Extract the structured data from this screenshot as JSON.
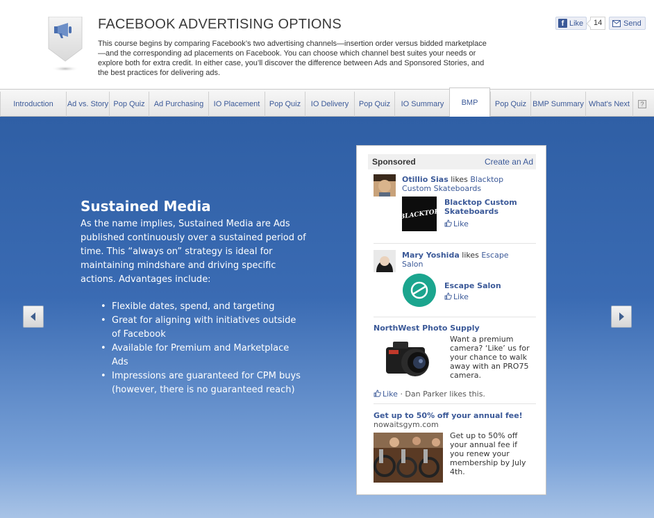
{
  "header": {
    "title": "FACEBOOK ADVERTISING OPTIONS",
    "description": "This course begins by comparing Facebook’s two advertising channels—insertion order versus bidded marketplace—and the corresponding ad placements on Facebook. You can choose which channel best suites your needs or explore both for extra credit. In either case, you’ll discover the difference between Ads and Sponsored Stories, and the best practices for delivering ads.",
    "like_label": "Like",
    "like_count": "14",
    "send_label": "Send"
  },
  "tabs": [
    {
      "label": "Introduction"
    },
    {
      "label": "Ad vs. Story"
    },
    {
      "label": "Pop Quiz"
    },
    {
      "label": "Ad Purchasing"
    },
    {
      "label": "IO Placement"
    },
    {
      "label": "Pop Quiz"
    },
    {
      "label": "IO Delivery"
    },
    {
      "label": "Pop Quiz"
    },
    {
      "label": "IO Summary"
    },
    {
      "label": "BMP",
      "active": true
    },
    {
      "label": "Pop Quiz"
    },
    {
      "label": "BMP Summary"
    },
    {
      "label": "What's Next"
    }
  ],
  "help_label": "?",
  "slide": {
    "title": "Sustained Media",
    "body": "As the name implies, Sustained Media are Ads published continuously over a sustained period of time. This “always on” strategy is ideal for maintaining mindshare and driving specific actions. Advantages include:",
    "bullets": [
      "Flexible dates, spend, and targeting",
      "Great for aligning with initiatives outside of Facebook",
      "Available for Premium and Marketplace Ads",
      "Impressions are guaranteed for CPM buys (however, there is no guaranteed reach)"
    ]
  },
  "ads": {
    "sponsored_label": "Sponsored",
    "create_ad_label": "Create an Ad",
    "story1": {
      "user": "Otillio Sias",
      "verb": "likes",
      "page": "Blacktop Custom Skateboards",
      "page_title": "Blacktop Custom Skateboards",
      "like_label": "Like",
      "logo_text": "BLACKTOP"
    },
    "story2": {
      "user": "Mary Yoshida",
      "verb": "likes",
      "page": "Escape Salon",
      "page_title": "Escape Salon",
      "like_label": "Like"
    },
    "ad1": {
      "title": "NorthWest Photo Supply",
      "body": "Want a premium camera? ‘Like’ us for your chance to walk away with an PRO75 camera.",
      "like_label": "Like",
      "social": "· Dan Parker likes this."
    },
    "ad2": {
      "title": "Get up to 50% off your annual fee!",
      "url": "nowaitsgym.com",
      "body": "Get up to 50% off your annual fee if you renew your membership by July 4th."
    }
  },
  "colors": {
    "fb_blue": "#3b5998",
    "content_top": "#2f5fa5",
    "content_bottom": "#a8c3e6"
  }
}
